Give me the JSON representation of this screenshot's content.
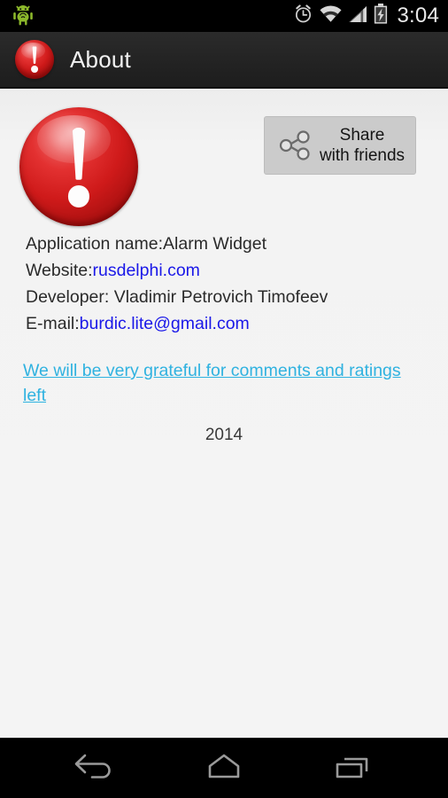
{
  "status_bar": {
    "debug_icon": "android-bug-icon",
    "icons": [
      "alarm-clock-icon",
      "wifi-icon",
      "cellular-signal-icon",
      "battery-charging-icon"
    ],
    "time": "3:04",
    "background_color": "#000000"
  },
  "action_bar": {
    "app_icon": "alert-exclamation-icon",
    "title": "About",
    "background_color": "#232323",
    "title_color": "#f2f2f2"
  },
  "main": {
    "logo_icon": "alert-exclamation-icon",
    "share_button": {
      "icon": "share-icon",
      "line1": "Share",
      "line2": "with friends",
      "background_color": "#cbcbcb"
    },
    "info_lines": [
      {
        "label": "Application name:",
        "value": "Alarm Widget",
        "value_is_link": false
      },
      {
        "label": "Website:",
        "value": "rusdelphi.com",
        "value_is_link": true
      },
      {
        "label": "Developer: ",
        "value": "Vladimir Petrovich Timofeev",
        "value_is_link": false
      },
      {
        "label": "E-mail:",
        "value": "burdic.lite@gmail.com",
        "value_is_link": true
      }
    ],
    "rate_link": "We will be very grateful for comments and ratings left",
    "year": "2014",
    "link_color": "#1a18e8",
    "rate_link_color": "#2fb2e0",
    "background_color": "#f2f2f2"
  },
  "nav_bar": {
    "buttons": [
      {
        "name": "back-button",
        "icon": "back-arrow-icon"
      },
      {
        "name": "home-button",
        "icon": "home-icon"
      },
      {
        "name": "recents-button",
        "icon": "recent-apps-icon"
      }
    ],
    "background_color": "#000000"
  }
}
